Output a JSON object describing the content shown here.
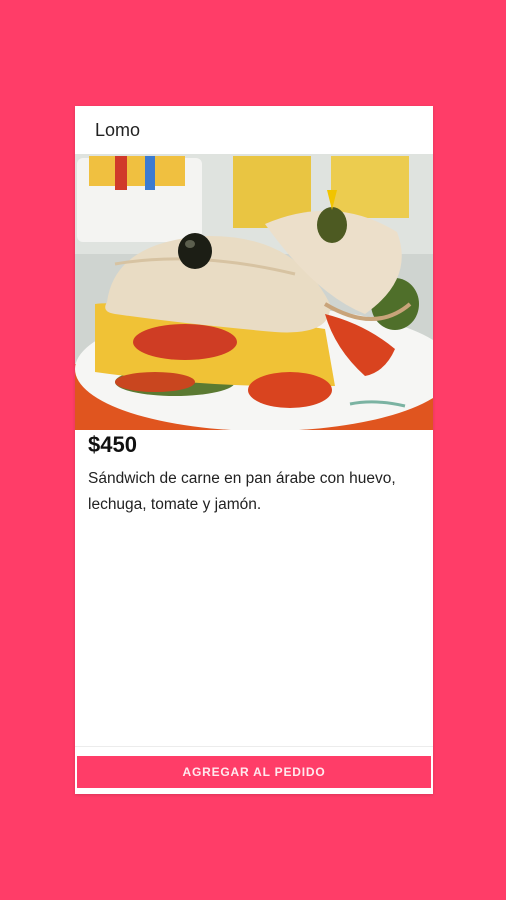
{
  "product": {
    "title": "Lomo",
    "price": "$450",
    "description": "Sándwich de carne en pan árabe con huevo, lechuga, tomate y jamón.",
    "image_icon": "sandwich-photo"
  },
  "actions": {
    "add_to_order_label": "AGREGAR AL PEDIDO"
  },
  "colors": {
    "background": "#ff3d68",
    "card": "#ffffff",
    "button": "#ff3d68"
  }
}
